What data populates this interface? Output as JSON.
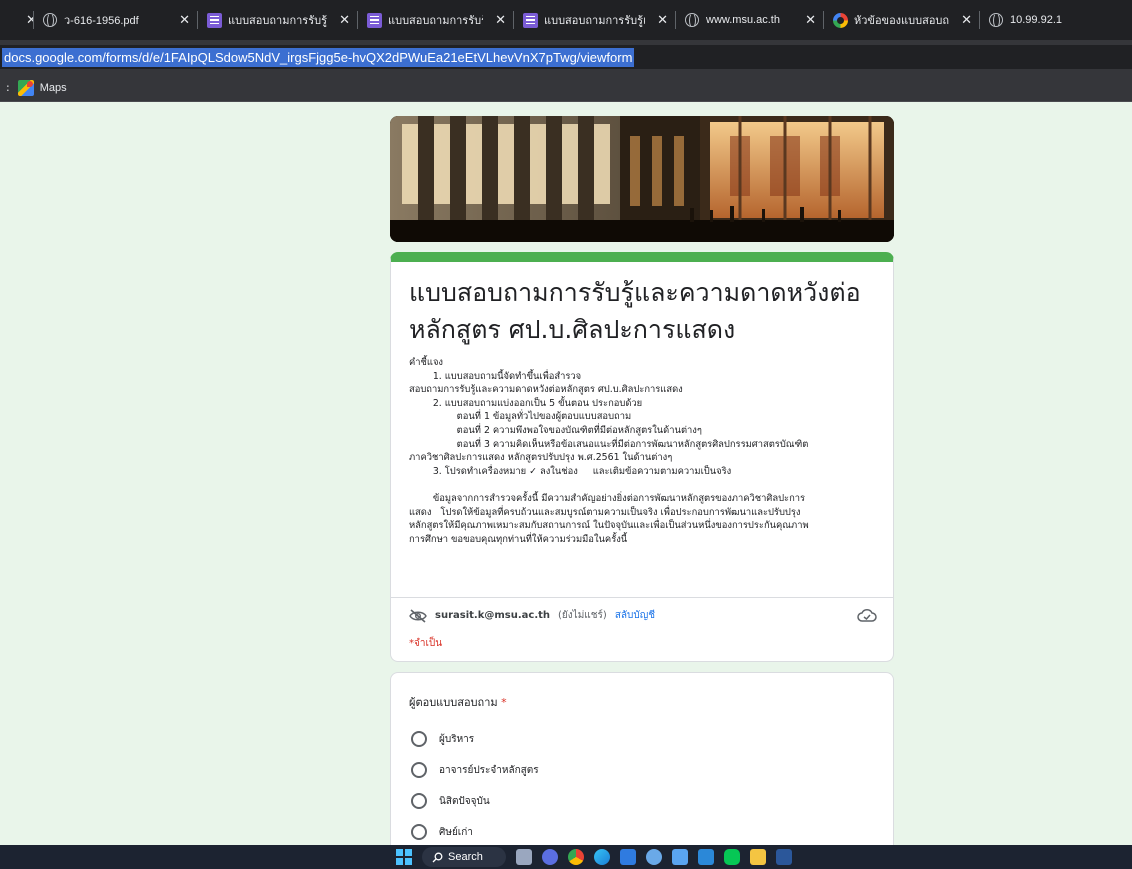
{
  "browser": {
    "tabs": [
      {
        "title": "",
        "icon": "partial-tab",
        "close": "✕",
        "width": 34
      },
      {
        "title": "ว-616-1956.pdf",
        "icon": "globe-icon",
        "close": "✕",
        "width": 164
      },
      {
        "title": "แบบสอบถามการรับรู้และ",
        "icon": "forms-icon",
        "close": "✕",
        "width": 160
      },
      {
        "title": "แบบสอบถามการรับรู้และ",
        "icon": "forms-icon",
        "close": "✕",
        "width": 156
      },
      {
        "title": "แบบสอบถามการรับรู้และ",
        "icon": "forms-icon",
        "close": "✕",
        "width": 162
      },
      {
        "title": "www.msu.ac.th",
        "icon": "globe-icon",
        "close": "✕",
        "width": 148
      },
      {
        "title": "หัวข้อของแบบสอบถาม -",
        "icon": "google-icon",
        "close": "✕",
        "width": 156
      },
      {
        "title": "10.99.92.1",
        "icon": "globe-icon",
        "close": "",
        "width": 152
      }
    ],
    "url": "docs.google.com/forms/d/e/1FAIpQLSdow5NdV_irgsFjgg5e-hvQX2dPWuEa21eEtVLhevVnX7pTwg/viewform",
    "bookmarks": [
      {
        "label": "Maps",
        "icon": "maps-icon"
      }
    ]
  },
  "form": {
    "title_line1": "แบบสอบถามการรับรู้และความดาดหวังต่อ",
    "title_line2": "หลักสูตร ศป.บ.ศิลปะการแสดง",
    "description": [
      "คำชี้แจง",
      "        1. แบบสอบถามนี้จัดทำขึ้นเพื่อสำรวจ",
      "สอบถามการรับรู้และความดาดหวังต่อหลักสูตร ศป.บ.ศิลปะการแสดง",
      "        2. แบบสอบถามแบ่งออกเป็น 5 ขั้นตอน ประกอบด้วย",
      "                ตอนที่ 1 ข้อมูลทั่วไปของผู้ตอบแบบสอบถาม",
      "                ตอนที่ 2 ความพึงพอใจของบัณฑิตที่มีต่อหลักสูตรในด้านต่างๆ",
      "                ตอนที่ 3 ความคิดเห็นหรือข้อเสนอแนะที่มีต่อการพัฒนาหลักสูตรศิลปกรรมศาสตรบัณฑิต",
      "ภาควิชาศิลปะการแสดง หลักสูตรปรับปรุง พ.ศ.2561 ในด้านต่างๆ",
      "        3. โปรดทำเครื่องหมาย ✓ ลงในช่อง     และเติมข้อความตามความเป็นจริง",
      "",
      "        ข้อมูลจากการสำรวจครั้งนี้ มีความสำคัญอย่างยิ่งต่อการพัฒนาหลักสูตรของภาควิชาศิลปะการ",
      "แสดง   โปรดให้ข้อมูลที่ครบถ้วนและสมบูรณ์ตามความเป็นจริง เพื่อประกอบการพัฒนาและปรับปรุง",
      "หลักสูตรให้มีคุณภาพเหมาะสมกับสถานการณ์ ในปัจจุบันและเพื่อเป็นส่วนหนึ่งของการประกันคุณภาพ",
      "การศึกษา ขอขอบคุณทุกท่านที่ให้ความร่วมมือในครั้งนี้"
    ],
    "account_email": "surasit.k@msu.ac.th",
    "account_status": "(ยังไม่แชร์)",
    "switch_account": "สลับบัญชี",
    "required_note": "*จำเป็น",
    "question": {
      "title": "ผู้ตอบแบบสอบถาม",
      "required_mark": "*",
      "options": [
        "ผู้บริหาร",
        "อาจารย์ประจำหลักสูตร",
        "นิสิตปัจจุบัน",
        "ศิษย์เก่า"
      ]
    }
  },
  "taskbar": {
    "search_label": "Search",
    "apps": [
      "task-view-icon",
      "meet-icon",
      "chrome-icon",
      "edge-icon",
      "store-icon",
      "settings-icon",
      "notepad-icon",
      "remote-icon",
      "line-icon",
      "folder-icon",
      "word-icon"
    ]
  },
  "colors": {
    "page_bg": "#e9f5ea",
    "form_accent": "#4caf50",
    "required_red": "#d93025",
    "link_blue": "#1a73e8",
    "url_highlight": "#3c6fd1"
  }
}
